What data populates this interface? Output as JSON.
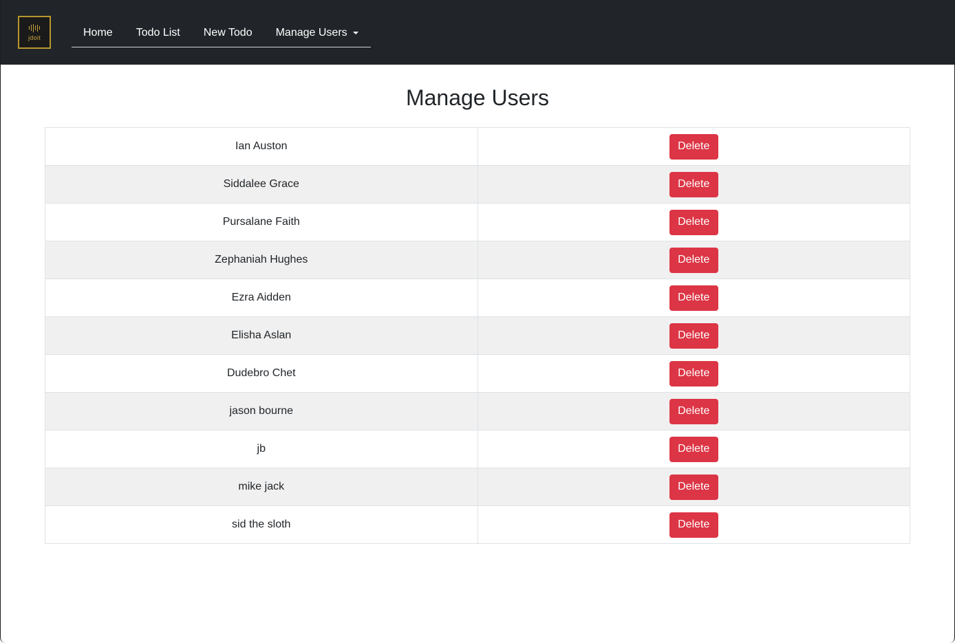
{
  "logo": {
    "text": "jdoit"
  },
  "nav": {
    "items": [
      {
        "label": "Home"
      },
      {
        "label": "Todo List"
      },
      {
        "label": "New Todo"
      },
      {
        "label": "Manage Users"
      }
    ]
  },
  "page": {
    "title": "Manage Users"
  },
  "users": {
    "delete_label": "Delete",
    "rows": [
      {
        "name": "Ian Auston"
      },
      {
        "name": "Siddalee Grace"
      },
      {
        "name": "Pursalane Faith"
      },
      {
        "name": "Zephaniah Hughes"
      },
      {
        "name": "Ezra Aidden"
      },
      {
        "name": "Elisha Aslan"
      },
      {
        "name": "Dudebro Chet"
      },
      {
        "name": "jason bourne"
      },
      {
        "name": "jb"
      },
      {
        "name": "mike jack"
      },
      {
        "name": "sid the sloth"
      }
    ]
  },
  "colors": {
    "navbar": "#212529",
    "danger": "#dc3545",
    "logo_gold": "#c9a43a"
  }
}
